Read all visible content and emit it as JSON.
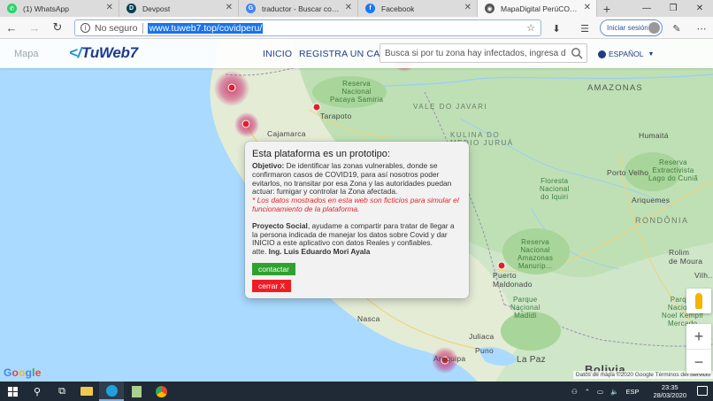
{
  "browser": {
    "tabs": [
      {
        "label": "(1) WhatsApp",
        "icon": "whatsapp-icon",
        "color": "#25d366",
        "glyph": "✆"
      },
      {
        "label": "Devpost",
        "icon": "devpost-icon",
        "color": "#003e54",
        "glyph": "D"
      },
      {
        "label": "traductor - Buscar con Google",
        "icon": "google-icon",
        "color": "#4285f4",
        "glyph": "G"
      },
      {
        "label": "Facebook",
        "icon": "facebook-icon",
        "color": "#1877f2",
        "glyph": "f"
      },
      {
        "label": "MapaDigital PerúCOVID19",
        "icon": "map-pin-icon",
        "color": "#555555",
        "glyph": "◉"
      }
    ],
    "address": {
      "security_label": "No seguro",
      "url": "www.tuweb7.top/covidperu/"
    },
    "signin_label": "Iniciar sesión"
  },
  "site": {
    "logo": {
      "slash": "</",
      "name": "TuWeb7"
    },
    "map_tab": "Mapa",
    "nav": {
      "inicio": "INICIO",
      "registrar": "REGISTRA UN CASO"
    },
    "search": {
      "placeholder": "Busca si por tu zona hay infectados, ingresa dirección"
    },
    "language": "ESPAÑOL"
  },
  "modal": {
    "title": "Esta plataforma es un prototipo:",
    "objective_label": "Objetivo:",
    "objective_text": " De identificar las zonas vulnerables, donde se confirmaron casos de COVID19, para así nosotros poder evitarlos, no transitar por esa Zona y las autoridades puedan actuar: fumigar y controlar la Zona afectada.",
    "warning": "* Los datos mostrados en esta web son ficticios para simular el funcionamiento de la plataforma.",
    "social_label": "Proyecto Social",
    "social_text": ", ayudame a compartir para tratar de llegar a la persona indicada de manejar los datos sobre Covid y dar INICIO a este aplicativo con datos Reales y confiables.",
    "signature_prefix": "atte. ",
    "signature_name": "Ing. Luis Eduardo Mori Ayala",
    "contact_button": "contactar",
    "close_button": "cerrar X"
  },
  "map": {
    "labels": {
      "reserve_pacaya": "Reserva\nNacional\nPacaya Samiria",
      "tarapoto": "Tarapoto",
      "cajamarca": "Cajamarca",
      "vale_do_javari": "VALE DO JAVARI",
      "kulina": "KULINA DO\nMEDIO JURUÁ",
      "amazonas": "AMAZONAS",
      "humaita": "Humaitá",
      "porto_velho": "Porto Velho",
      "lago_cuniã": "Reserva\nExtractivista\nLago do Cuniã",
      "nacional_bom_futuro": "Floresta\nNacional\ndo Iquiri",
      "rondonia": "RONDÔNIA",
      "rolim": "Rolim\nde Moura",
      "puerto_maldonado": "Puerto\nMaldonado",
      "reserva_tambopata": "Reserva\nNacional\nAmazonas\nManurip...",
      "nasca": "Nasca",
      "reserva_madidi": "Parque\nNacional\nMadidi",
      "juliaca": "Juliaca",
      "puno": "Puno",
      "la_paz": "La Paz",
      "arequipa": "Arequipa",
      "bolivia": "Bolivia",
      "ariquemes": "Ariquemes",
      "vilhena": "Vilh...",
      "norte": "Parque\nNacional\nNoel Kempff\nMercado"
    },
    "google": "Google",
    "attribution": "Datos de mapa ©2020 Google    Términos del Servicio"
  },
  "taskbar": {
    "lang": "ESP",
    "time": "23:35",
    "date": "28/03/2020"
  }
}
